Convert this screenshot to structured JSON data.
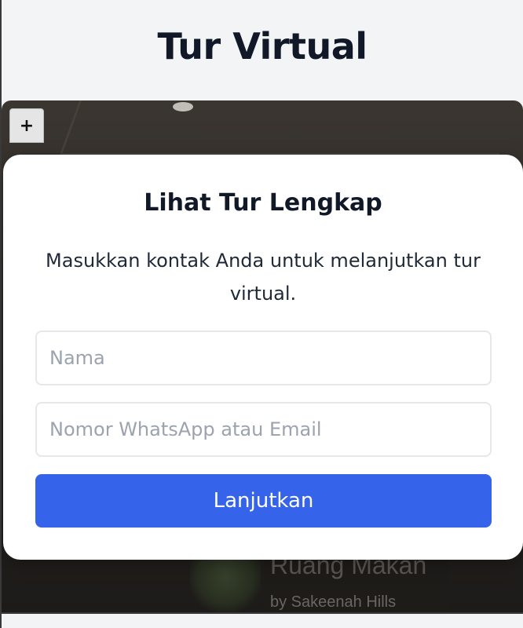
{
  "page": {
    "title": "Tur Virtual"
  },
  "viewer": {
    "zoom_in_label": "+",
    "scene_title": "Ruang Makan",
    "scene_subtitle": "by Sakeenah Hills"
  },
  "modal": {
    "title": "Lihat Tur Lengkap",
    "description": "Masukkan kontak Anda untuk melanjutkan tur virtual.",
    "name_placeholder": "Nama",
    "name_value": "",
    "contact_placeholder": "Nomor WhatsApp atau Email",
    "contact_value": "",
    "submit_label": "Lanjutkan"
  },
  "colors": {
    "accent": "#3563e9",
    "heading": "#111827",
    "placeholder": "#9ca3af",
    "background": "#f3f4f6"
  }
}
